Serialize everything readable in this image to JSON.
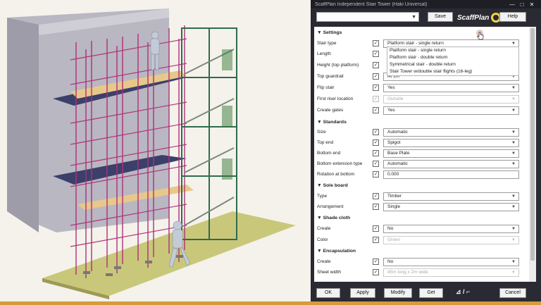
{
  "window": {
    "title": "ScaffPlan Independent Stair Tower (Haki Universal)"
  },
  "toolbar": {
    "save_label": "Save",
    "logo_text": "ScaffPlan",
    "help_label": "Help",
    "combo_value": ""
  },
  "sections": {
    "settings": "▼ Settings",
    "standards": "▼ Standards",
    "sole_board": "▼ Sole board",
    "shade_cloth": "▼ Shade cloth",
    "encapsulation": "▼ Encapsulation"
  },
  "rows": {
    "stair_type": {
      "label": "Stair type",
      "value": "Platform stair - single return"
    },
    "length": {
      "label": "Length"
    },
    "height": {
      "label": "Height (top platform)"
    },
    "top_guardrail": {
      "label": "Top guardrail",
      "value": "At 1m"
    },
    "flip_stair": {
      "label": "Flip stair",
      "value": "Yes"
    },
    "first_riser": {
      "label": "First riser location",
      "value": "Outside"
    },
    "create_gates": {
      "label": "Create gates",
      "value": "Yes"
    },
    "size": {
      "label": "Size",
      "value": "Automatic"
    },
    "top_end": {
      "label": "Top end",
      "value": "Spigot"
    },
    "bottom_end": {
      "label": "Bottom end",
      "value": "Base Plate"
    },
    "bottom_ext": {
      "label": "Bottom extension type",
      "value": "Automatic"
    },
    "rotation": {
      "label": "Rotation at bottom",
      "value": "0.000"
    },
    "sole_type": {
      "label": "Type",
      "value": "Timber"
    },
    "arrangement": {
      "label": "Arrangement",
      "value": "Single"
    },
    "shade_create": {
      "label": "Create",
      "value": "No"
    },
    "shade_color": {
      "label": "Color",
      "value": "Green"
    },
    "encap_create": {
      "label": "Create",
      "value": "No"
    },
    "sheet_width": {
      "label": "Sheet width",
      "value": "45m long x 2m wide"
    }
  },
  "dropdown_options": [
    "Platform stair - single return",
    "Platform stair - double return",
    "Symmetrical stair - double return",
    "Stair Tower w/double stair flights (16-leg)"
  ],
  "footer": {
    "ok": "OK",
    "apply": "Apply",
    "modify": "Modify",
    "get": "Get",
    "flip_glyph": "⊿ / ⌐",
    "cancel": "Cancel"
  },
  "colors": {
    "dialog_bg": "#2a2a33",
    "scaffold_tube": "#b0307a",
    "stair_frame": "#2f6b4e",
    "deck": "#e8c88a",
    "ground": "#c9c77a"
  }
}
